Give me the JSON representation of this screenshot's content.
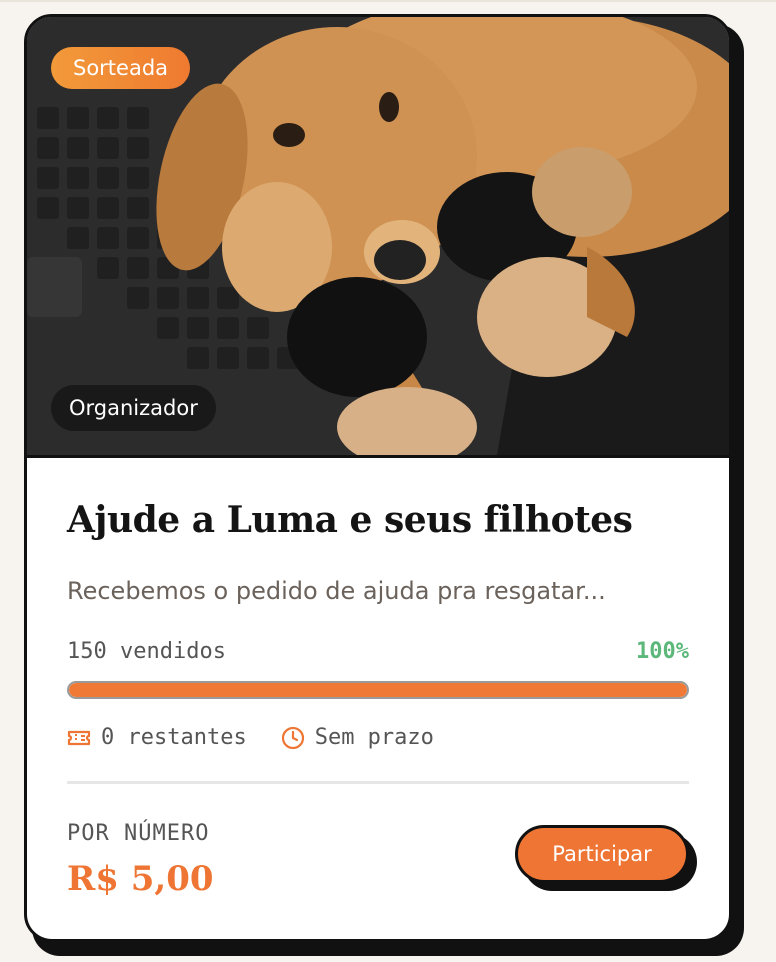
{
  "card": {
    "status_badge": "Sorteada",
    "organizer_badge": "Organizador",
    "title": "Ajude a Luma e seus filhotes",
    "description": "Recebemos o pedido de ajuda pra resgatar...",
    "sold_text": "150 vendidos",
    "percent_text": "100%",
    "progress": 1.0,
    "remaining_text": "0 restantes",
    "deadline_text": "Sem prazo",
    "per_label": "POR NÚMERO",
    "price": "R$ 5,00",
    "cta_label": "Participar",
    "icons": {
      "ticket": "ticket-icon",
      "clock": "clock-icon"
    },
    "colors": {
      "accent": "#ee7533",
      "success": "#5bb87a",
      "text": "#141414"
    }
  }
}
